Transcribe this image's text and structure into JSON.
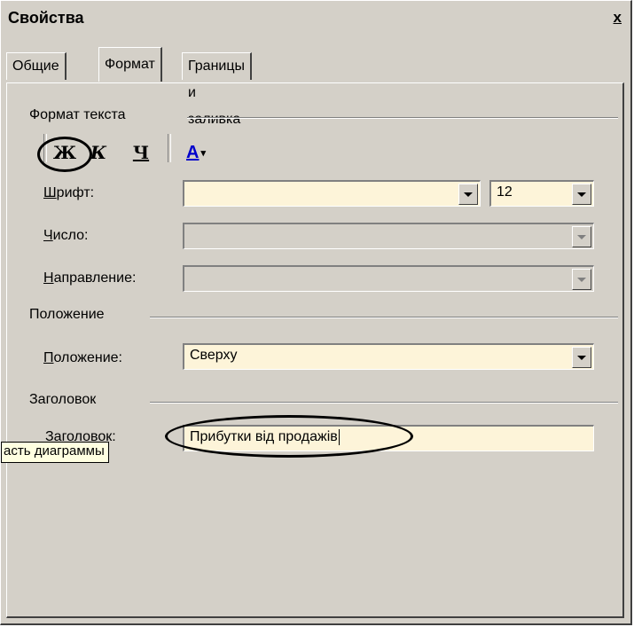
{
  "window": {
    "title": "Свойства",
    "close_label": "x"
  },
  "tabs": [
    {
      "label": "Общие",
      "active": false
    },
    {
      "label": "Формат",
      "active": true
    },
    {
      "label": "Границы и заливка",
      "active": false
    }
  ],
  "text_format": {
    "group_label": "Формат текста",
    "buttons": {
      "bold": "Ж",
      "italic": "К",
      "underline": "Ч",
      "color": "А"
    },
    "font_label_u": "Ш",
    "font_label_rest": "рифт:",
    "font_value": "",
    "size_value": "12",
    "number_label_u": "Ч",
    "number_label_rest": "исло:",
    "number_value": "",
    "direction_label_u": "Н",
    "direction_label_rest": "аправление:",
    "direction_value": ""
  },
  "position": {
    "group_label": "Положение",
    "field_label_u": "П",
    "field_label_rest": "оложение:",
    "value": "Сверху"
  },
  "title_section": {
    "group_label": "Заголовок",
    "field_label": "Заголовок:",
    "value": "Прибутки від продажів"
  },
  "tooltip": {
    "text": "асть диаграммы"
  },
  "colors": {
    "dialog_bg": "#d4d0c8",
    "field_bg": "#fdf4d9",
    "tooltip_bg": "#ffffe1",
    "font_color_accent": "#0000cc"
  }
}
